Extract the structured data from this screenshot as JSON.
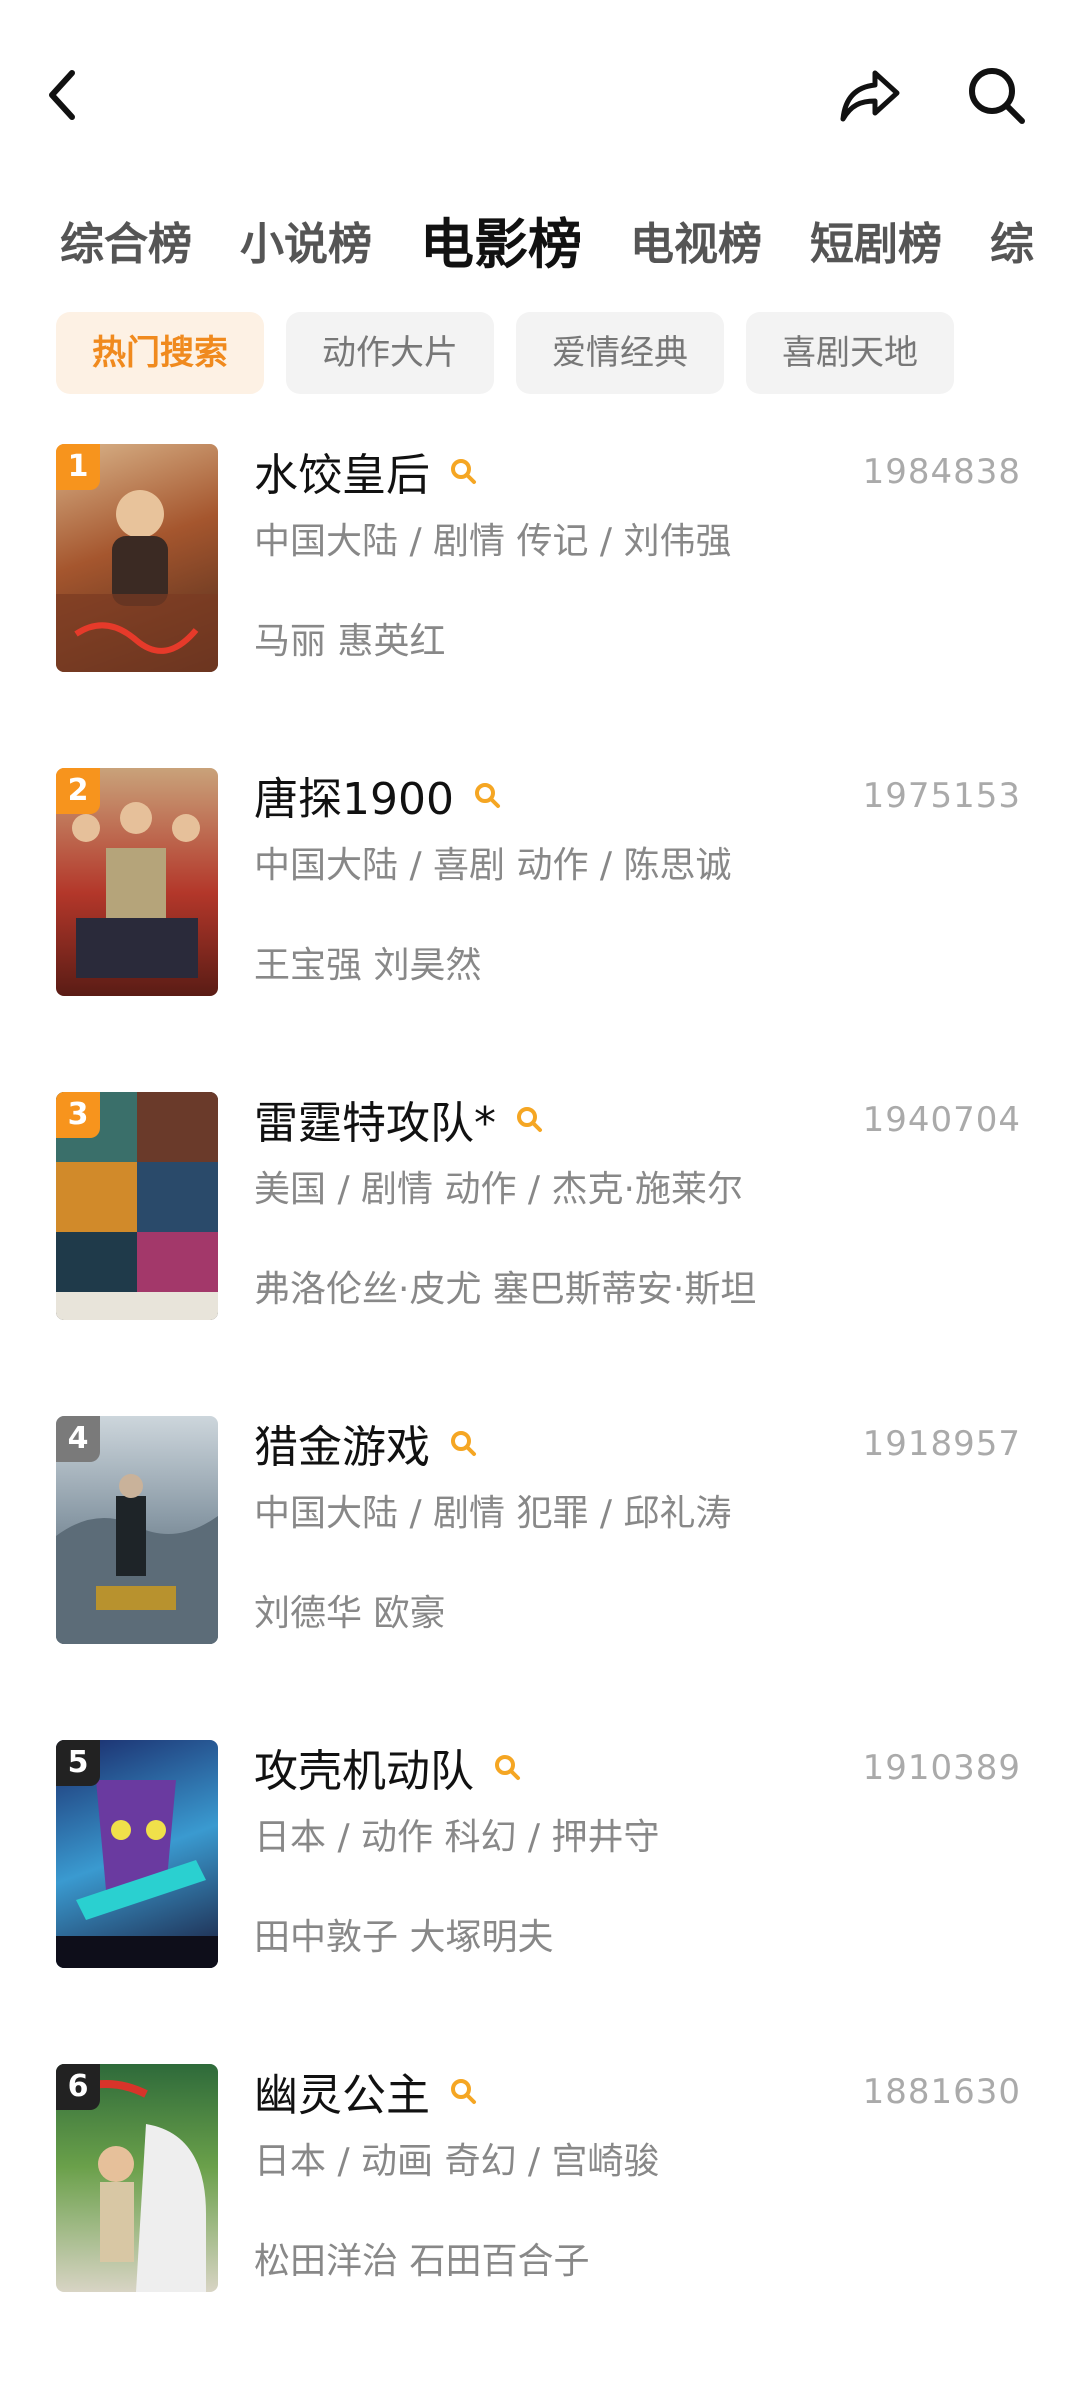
{
  "header": {
    "back_icon": "chevron-left-icon",
    "share_icon": "share-arrow-icon",
    "search_icon": "search-icon"
  },
  "tabs": [
    {
      "label": "综合榜"
    },
    {
      "label": "小说榜"
    },
    {
      "label": "电影榜",
      "active": true
    },
    {
      "label": "电视榜"
    },
    {
      "label": "短剧榜"
    },
    {
      "label": "综"
    }
  ],
  "chips": [
    {
      "label": "热门搜索",
      "active": true
    },
    {
      "label": "动作大片"
    },
    {
      "label": "爱情经典"
    },
    {
      "label": "喜剧天地"
    }
  ],
  "colors": {
    "accent": "#f08a1e",
    "rank_top": "#f7941d",
    "rank_gray": "#7a7a7a",
    "rank_dark": "#222222",
    "search_badge": "#f5a623"
  },
  "movies": [
    {
      "rank": "1",
      "title": "水饺皇后",
      "score": "1984838",
      "meta": "中国大陆 / 剧情 传记 / 刘伟强",
      "cast": "马丽 惠英红"
    },
    {
      "rank": "2",
      "title": "唐探1900",
      "score": "1975153",
      "meta": "中国大陆 / 喜剧 动作 / 陈思诚",
      "cast": "王宝强 刘昊然"
    },
    {
      "rank": "3",
      "title": "雷霆特攻队*",
      "score": "1940704",
      "meta": "美国 / 剧情 动作 / 杰克·施莱尔",
      "cast": "弗洛伦丝·皮尤 塞巴斯蒂安·斯坦"
    },
    {
      "rank": "4",
      "title": "猎金游戏",
      "score": "1918957",
      "meta": "中国大陆 / 剧情 犯罪 / 邱礼涛",
      "cast": "刘德华 欧豪"
    },
    {
      "rank": "5",
      "title": "攻壳机动队",
      "score": "1910389",
      "meta": "日本 / 动作 科幻 / 押井守",
      "cast": "田中敦子 大塚明夫"
    },
    {
      "rank": "6",
      "title": "幽灵公主",
      "score": "1881630",
      "meta": "日本 / 动画 奇幻 / 宫崎骏",
      "cast": "松田洋治 石田百合子"
    }
  ]
}
